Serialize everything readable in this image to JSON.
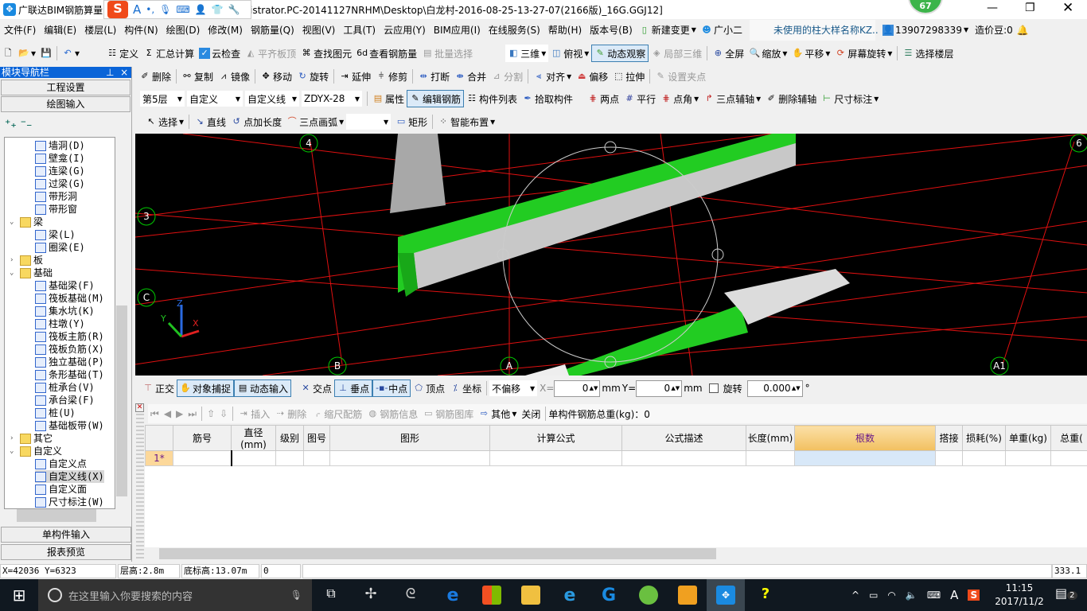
{
  "title": {
    "app": "广联达BIM钢筋算量",
    "path": "istrator.PC-20141127NRHM\\Desktop\\白龙村-2016-08-25-13-27-07(2166版)_16G.GGJ12]",
    "badge": "67"
  },
  "ime": {
    "brand": "S",
    "items": [
      "A",
      "•,",
      "mic-icon",
      "keyboard-icon",
      "user-icon",
      "shirt-icon",
      "wrench-icon"
    ]
  },
  "menu": [
    "文件(F)",
    "编辑(E)",
    "楼层(L)",
    "构件(N)",
    "绘图(D)",
    "修改(M)",
    "钢筋量(Q)",
    "视图(V)",
    "工具(T)",
    "云应用(Y)",
    "BIM应用(I)",
    "在线服务(S)",
    "帮助(H)",
    "版本号(B)"
  ],
  "menu_right": {
    "new_change": "新建变更",
    "assistant": "广小二",
    "notice": "未使用的柱大样名称KZ..",
    "phone": "13907298339",
    "beans": "造价豆:0"
  },
  "toolbar1": {
    "define": "定义",
    "sum": "汇总计算",
    "cloud_check": "云检查",
    "align_top": "平齐板顶",
    "find": "查找图元",
    "view_rebar": "查看钢筋量",
    "batch": "批量选择",
    "three_d": "三维",
    "top_view": "俯视",
    "orbit": "动态观察",
    "local_3d": "局部三维",
    "fullscreen": "全屏",
    "zoom": "缩放",
    "pan": "平移",
    "rotate_screen": "屏幕旋转",
    "select_floor": "选择楼层"
  },
  "toolbar2": {
    "delete": "删除",
    "copy": "复制",
    "mirror": "镜像",
    "move": "移动",
    "rotate": "旋转",
    "extend": "延伸",
    "trim": "修剪",
    "break": "打断",
    "merge": "合并",
    "split": "分割",
    "align": "对齐",
    "offset": "偏移",
    "stretch": "拉伸",
    "set_grip": "设置夹点"
  },
  "toolbar3": {
    "floor": "第5层",
    "type": "自定义",
    "subtype": "自定义线",
    "component": "ZDYX-28",
    "property": "属性",
    "edit_rebar": "编辑钢筋",
    "component_list": "构件列表",
    "pick": "拾取构件",
    "two_point": "两点",
    "parallel": "平行",
    "point_angle": "点角",
    "three_point_axis": "三点辅轴",
    "delete_axis": "删除辅轴",
    "dimension": "尺寸标注"
  },
  "toolbar4": {
    "select": "选择",
    "line": "直线",
    "point_length": "点加长度",
    "arc3": "三点画弧",
    "rect": "矩形",
    "smart": "智能布置"
  },
  "nav": {
    "header": "模块导航栏",
    "pin": "ᵖ",
    "close": "×",
    "project_settings": "工程设置",
    "drawing_input": "绘图输入",
    "single_input": "单构件输入",
    "report": "报表预览",
    "tree": [
      {
        "label": "墙洞(D)",
        "level": 2
      },
      {
        "label": "壁龛(I)",
        "level": 2
      },
      {
        "label": "连梁(G)",
        "level": 2
      },
      {
        "label": "过梁(G)",
        "level": 2
      },
      {
        "label": "带形洞",
        "level": 2
      },
      {
        "label": "带形窗",
        "level": 2
      },
      {
        "label": "梁",
        "level": 1,
        "folder": true,
        "expanded": true
      },
      {
        "label": "梁(L)",
        "level": 2
      },
      {
        "label": "圈梁(E)",
        "level": 2
      },
      {
        "label": "板",
        "level": 1,
        "folder": true,
        "expanded": false
      },
      {
        "label": "基础",
        "level": 1,
        "folder": true,
        "expanded": true
      },
      {
        "label": "基础梁(F)",
        "level": 2
      },
      {
        "label": "筏板基础(M)",
        "level": 2
      },
      {
        "label": "集水坑(K)",
        "level": 2
      },
      {
        "label": "柱墩(Y)",
        "level": 2
      },
      {
        "label": "筏板主筋(R)",
        "level": 2
      },
      {
        "label": "筏板负筋(X)",
        "level": 2
      },
      {
        "label": "独立基础(P)",
        "level": 2
      },
      {
        "label": "条形基础(T)",
        "level": 2
      },
      {
        "label": "桩承台(V)",
        "level": 2
      },
      {
        "label": "承台梁(F)",
        "level": 2
      },
      {
        "label": "桩(U)",
        "level": 2
      },
      {
        "label": "基础板带(W)",
        "level": 2
      },
      {
        "label": "其它",
        "level": 1,
        "folder": true,
        "expanded": false
      },
      {
        "label": "自定义",
        "level": 1,
        "folder": true,
        "expanded": true
      },
      {
        "label": "自定义点",
        "level": 2
      },
      {
        "label": "自定义线(X)",
        "level": 2,
        "selected": true
      },
      {
        "label": "自定义面",
        "level": 2
      },
      {
        "label": "尺寸标注(W)",
        "level": 2
      }
    ]
  },
  "viewport": {
    "axis_labels": [
      "4",
      "6",
      "3",
      "C",
      "B",
      "A",
      "A1"
    ],
    "axes": {
      "x": "X",
      "y": "Y",
      "z": "Z"
    },
    "colors": {
      "background": "#000000",
      "grid": "#e01010",
      "beam_green": "#22dd22",
      "beam_grey": "#c8c8c8"
    }
  },
  "snap": {
    "ortho": "正交",
    "object_snap": "对象捕捉",
    "dynamic_input": "动态输入",
    "intersection": "交点",
    "perpendicular": "垂点",
    "midpoint": "中点",
    "vertex": "顶点",
    "coordinate": "坐标",
    "offset_mode": "不偏移",
    "x_label": "X=",
    "x_value": "0",
    "mm1": "mm",
    "y_label": "Y=",
    "y_value": "0",
    "mm2": "mm",
    "rotate_label": "旋转",
    "rotate_value": "0.000",
    "degree": "°"
  },
  "rebar_toolbar": {
    "insert": "插入",
    "delete": "删除",
    "scale_rebar": "缩尺配筋",
    "rebar_info": "钢筋信息",
    "rebar_library": "钢筋图库",
    "other": "其他",
    "close": "关闭",
    "total_weight": "单构件钢筋总重(kg)：0"
  },
  "table": {
    "headers": [
      "",
      "筋号",
      "直径(mm)",
      "级别",
      "图号",
      "图形",
      "计算公式",
      "公式描述",
      "长度(mm)",
      "根数",
      "搭接",
      "损耗(%)",
      "单重(kg)",
      "总重("
    ],
    "rows": [
      [
        "1*",
        "",
        "",
        "",
        "",
        "",
        "",
        "",
        "",
        "",
        "",
        "",
        "",
        ""
      ]
    ]
  },
  "status": {
    "coords": "X=42036 Y=6323",
    "floor_height": "层高:2.8m",
    "base_elev": "底标高:13.07m",
    "value": "0",
    "fps": "333.1 FPS"
  },
  "taskbar": {
    "search_placeholder": "在这里输入你要搜索的内容",
    "time": "11:15",
    "date": "2017/11/2",
    "notifications": "2",
    "ime_a": "A"
  }
}
